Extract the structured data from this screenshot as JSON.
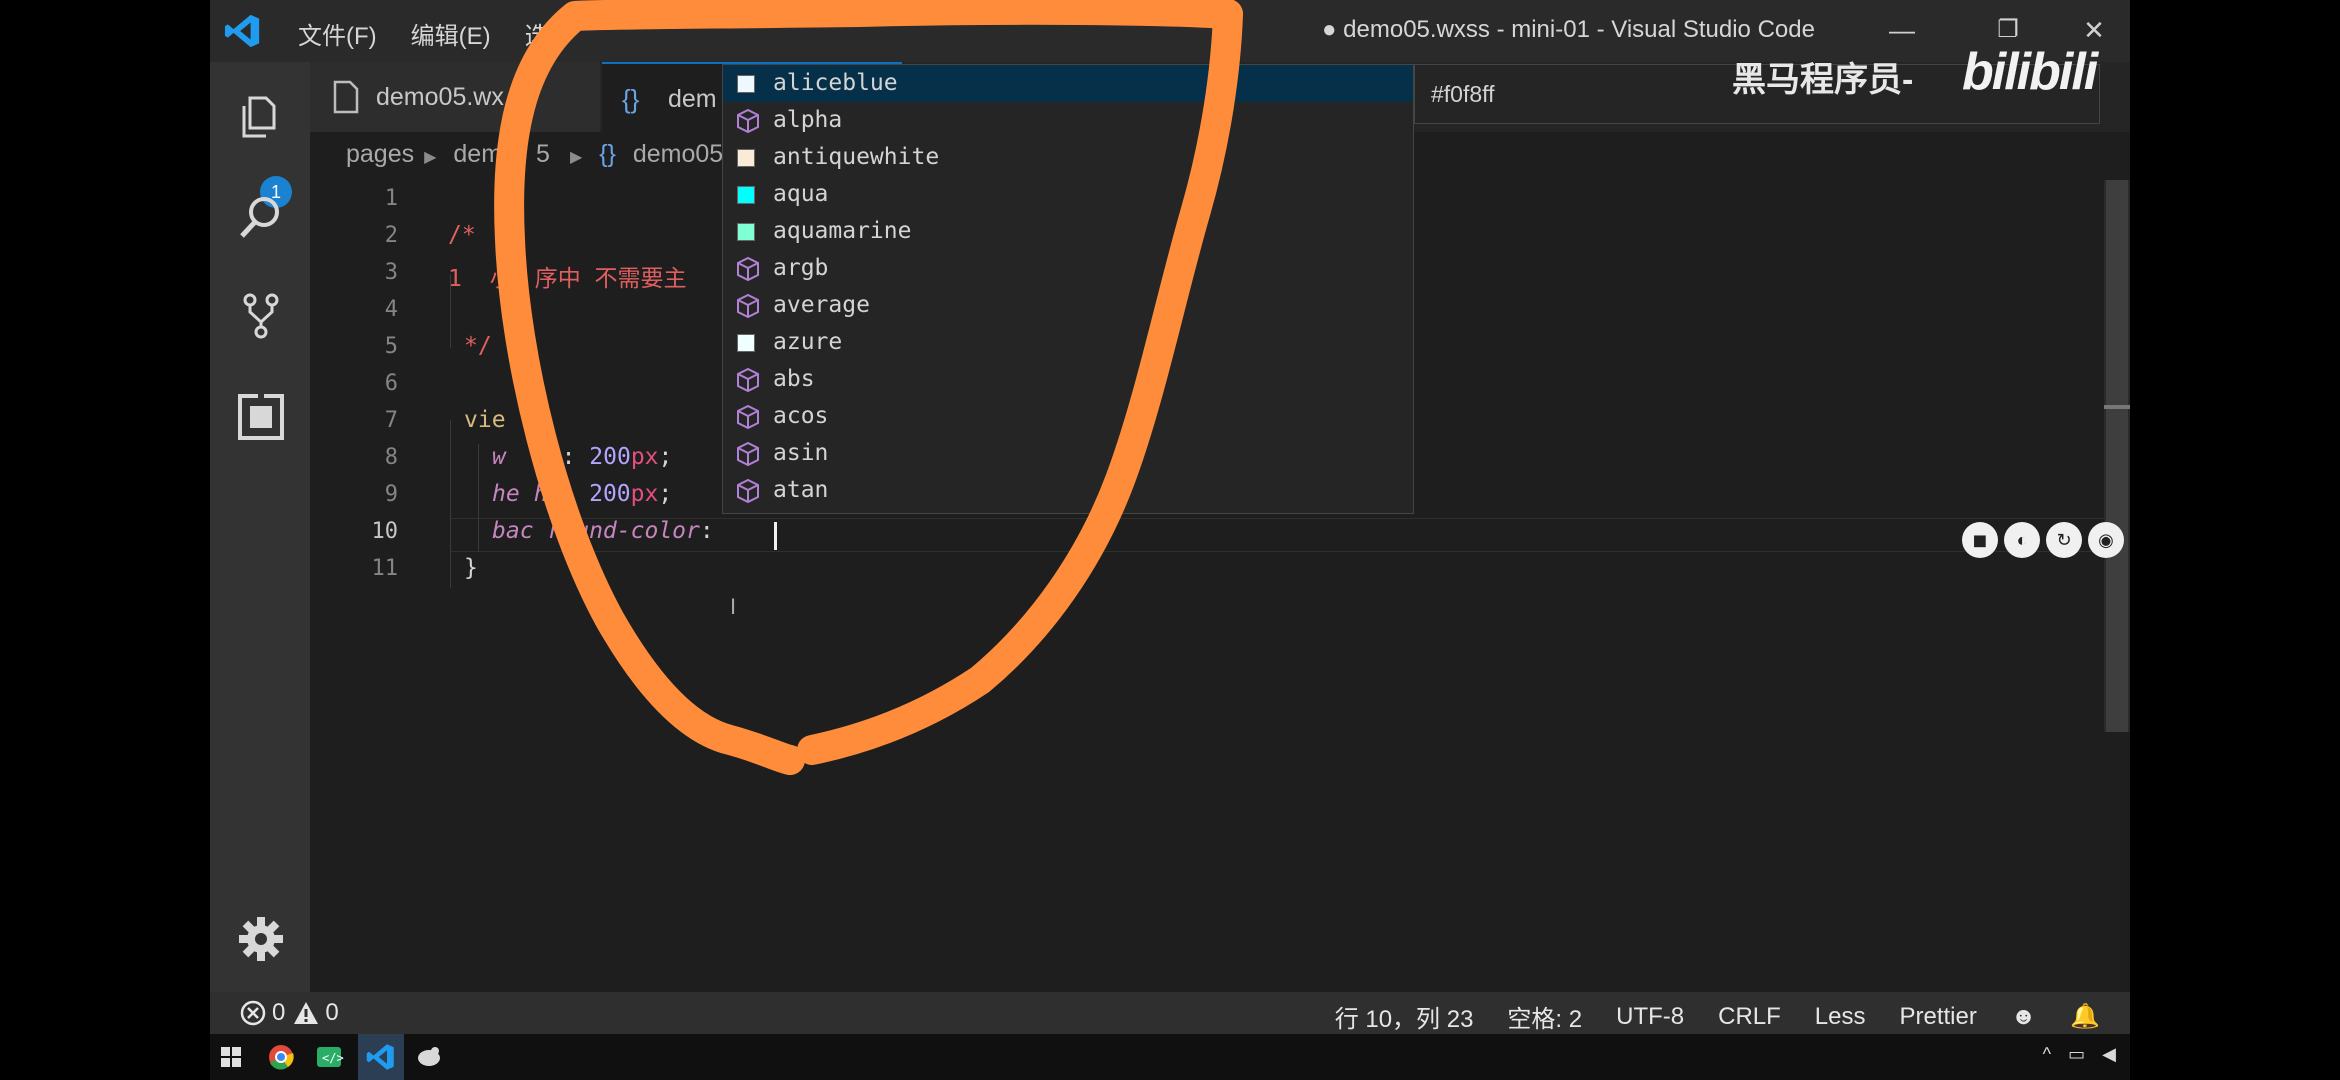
{
  "app": {
    "window_title": "● demo05.wxss - mini-01 - Visual Studio Code",
    "menu": [
      "文件(F)",
      "编辑(E)",
      "选"
    ],
    "window_buttons": [
      "—",
      "❐",
      "✕"
    ]
  },
  "activity": {
    "explorer_badge": "1"
  },
  "tabs": [
    {
      "label": "demo05.wx"
    },
    {
      "label": "dem"
    }
  ],
  "breadcrumb": {
    "a": "pages",
    "b": "dem",
    "b2": "5",
    "c": "demo05"
  },
  "code": {
    "line_numbers": [
      "1",
      "2",
      "3",
      "4",
      "5",
      "6",
      "7",
      "8",
      "9",
      "10",
      "11"
    ],
    "l2": "/*",
    "l3_num": "1 ",
    "l3_a": "小",
    "l3_b": "序中 不需要主",
    "l5": "*/",
    "l7": "vie",
    "l8_p1": "w",
    "l8_p2": "th",
    "l8_sep": ": ",
    "l8_num": "200",
    "l8_unit": "px",
    "l8_end": ";",
    "l9_p1": "he",
    "l9_p2": "ht",
    "l9_sep": ": ",
    "l9_num": "200",
    "l9_unit": "px",
    "l9_end": ";",
    "l10_p1": "bac",
    "l10_p2": "round-color",
    "l10_sep": ": ",
    "l11": "}"
  },
  "suggest": {
    "items": [
      {
        "label": "aliceblue",
        "kind": "color",
        "color": "#f0f8ff"
      },
      {
        "label": "alpha",
        "kind": "function"
      },
      {
        "label": "antiquewhite",
        "kind": "color",
        "color": "#faebd7"
      },
      {
        "label": "aqua",
        "kind": "color",
        "color": "#00ffff"
      },
      {
        "label": "aquamarine",
        "kind": "color",
        "color": "#7fffd4"
      },
      {
        "label": "argb",
        "kind": "function"
      },
      {
        "label": "average",
        "kind": "function"
      },
      {
        "label": "azure",
        "kind": "color",
        "color": "#f0ffff"
      },
      {
        "label": "abs",
        "kind": "function"
      },
      {
        "label": "acos",
        "kind": "function"
      },
      {
        "label": "asin",
        "kind": "function"
      },
      {
        "label": "atan",
        "kind": "function"
      }
    ],
    "detail": "#f0f8ff"
  },
  "watermark": {
    "text": "黑马程序员-",
    "logo": "bilibili"
  },
  "status": {
    "errors": "0",
    "warnings": "0",
    "position": "行 10，列 23",
    "spaces": "空格: 2",
    "encoding": "UTF-8",
    "eol": "CRLF",
    "language": "Less",
    "formatter": "Prettier"
  },
  "colors": {
    "accent": "#0e70c0",
    "annotation": "#ff8c3a"
  }
}
